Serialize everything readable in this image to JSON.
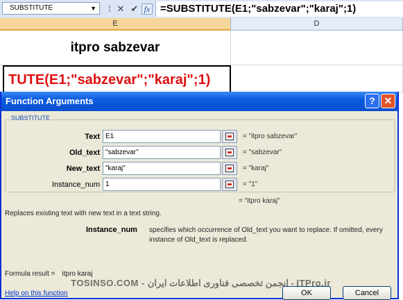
{
  "formula_bar": {
    "name_box": "SUBSTITUTE",
    "formula": "=SUBSTITUTE(E1;\"sabzevar\";\"karaj\";1)"
  },
  "sheet": {
    "columns": [
      "E",
      "D"
    ],
    "cell_e1": "itpro sabzevar",
    "cell_e2": "TUTE(E1;\"sabzevar\";\"karaj\";1)"
  },
  "dialog": {
    "title": "Function Arguments",
    "function_name": "SUBSTITUTE",
    "args": [
      {
        "label": "Text",
        "value": "E1",
        "result": "=  \"itpro sabzevar\""
      },
      {
        "label": "Old_text",
        "value": "\"sabzevar\"",
        "result": "=  \"sabzevar\""
      },
      {
        "label": "New_text",
        "value": "\"karaj\"",
        "result": "=  \"karaj\""
      },
      {
        "label": "Instance_num",
        "value": "1",
        "result": "=  \"1\""
      }
    ],
    "function_result": "=  \"itpro karaj\"",
    "description": "Replaces existing text with new text in a text string.",
    "arg_help_name": "Instance_num",
    "arg_help_text": "specifies which occurrence of Old_text you want to replace. If omitted, every instance of Old_text is replaced.",
    "formula_result_label": "Formula result =",
    "formula_result_value": "itpro karaj",
    "help_link": "Help on this function",
    "ok": "OK",
    "cancel": "Cancel",
    "watermark": "TOSINSO.COM - انجمن تخصصی فناوری اطلاعات ایران - ITPro.ir"
  }
}
